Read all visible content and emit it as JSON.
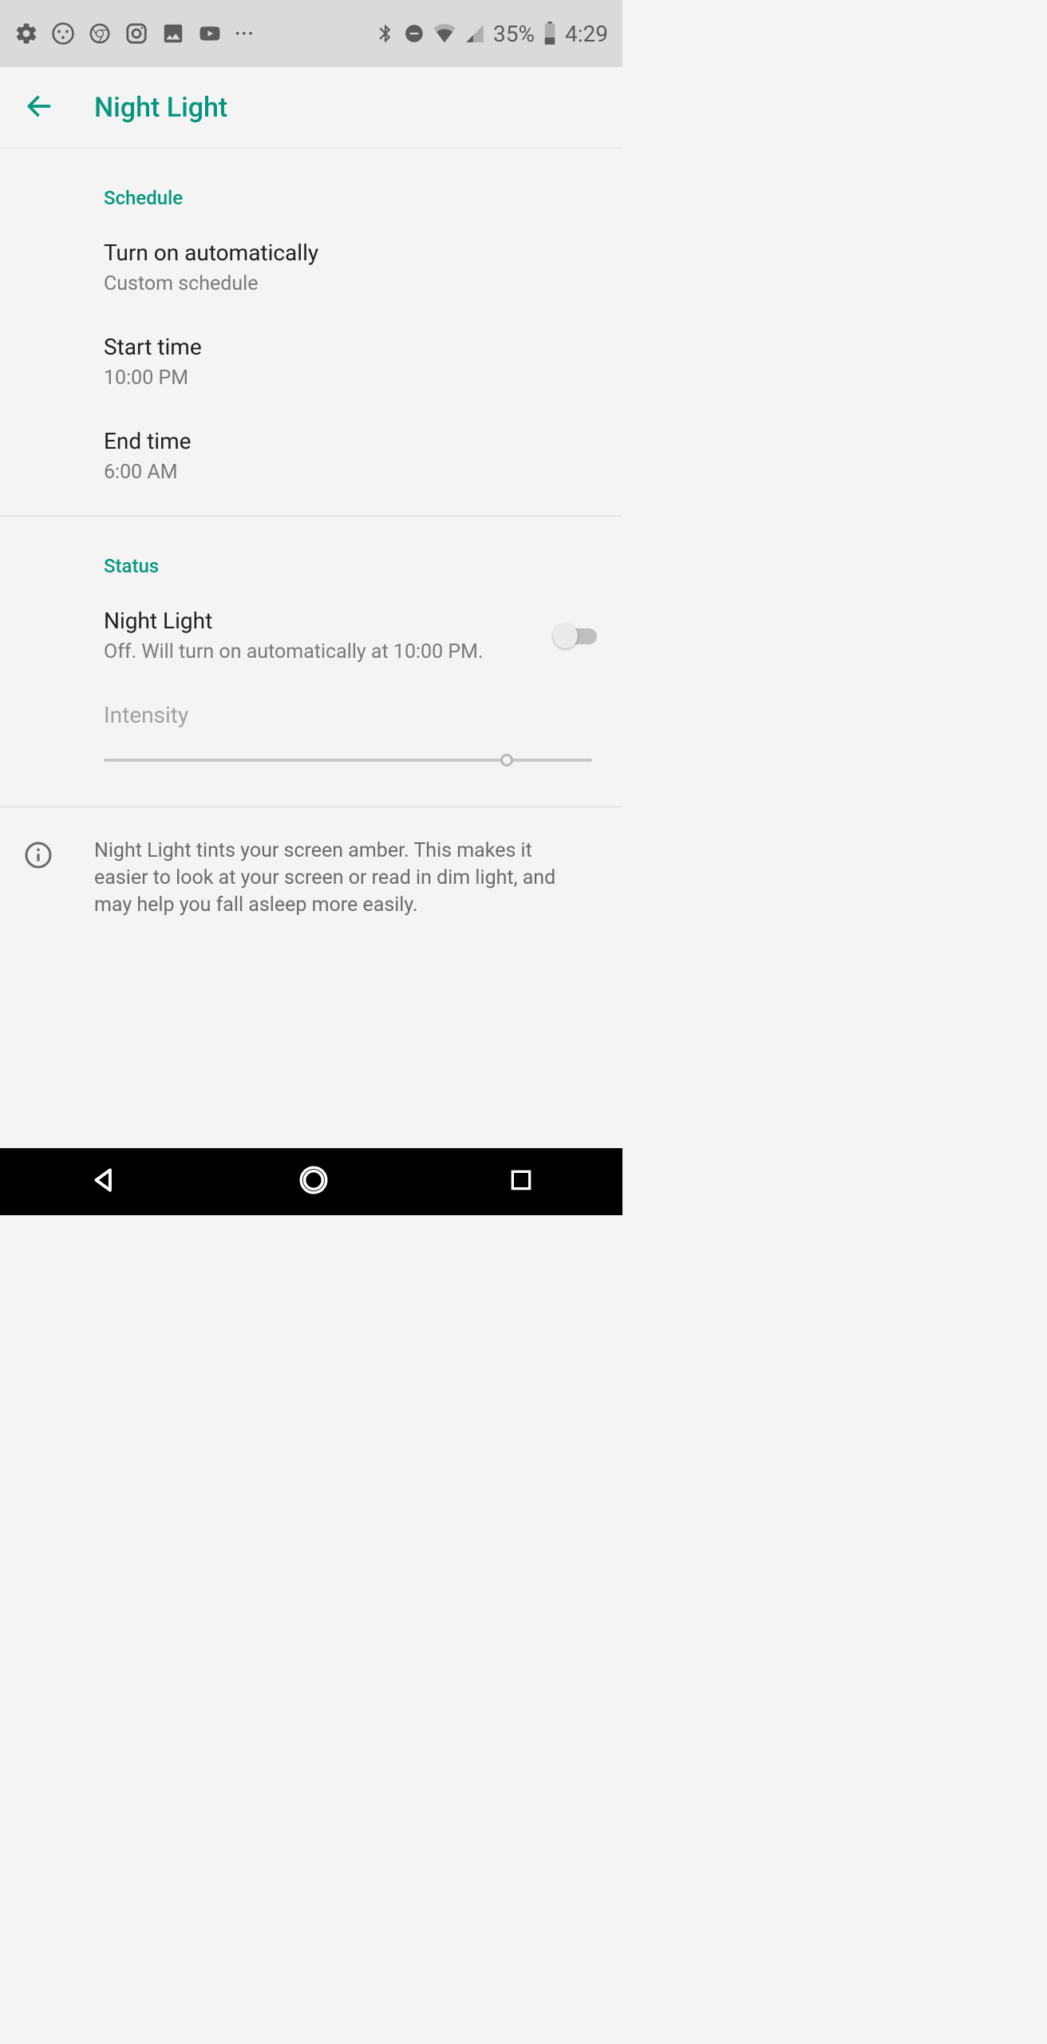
{
  "statusBar": {
    "battery": "35%",
    "time": "4:29"
  },
  "appBar": {
    "title": "Night Light"
  },
  "sections": {
    "schedule": {
      "header": "Schedule",
      "turnOn": {
        "title": "Turn on automatically",
        "subtitle": "Custom schedule"
      },
      "startTime": {
        "title": "Start time",
        "subtitle": "10:00 PM"
      },
      "endTime": {
        "title": "End time",
        "subtitle": "6:00 AM"
      }
    },
    "status": {
      "header": "Status",
      "nightLight": {
        "title": "Night Light",
        "subtitle": "Off. Will turn on automatically at 10:00 PM.",
        "enabled": false
      },
      "intensity": {
        "title": "Intensity",
        "value": 82.5
      }
    },
    "info": {
      "text": "Night Light tints your screen amber. This makes it easier to look at your screen or read in dim light, and may help you fall asleep more easily."
    }
  }
}
